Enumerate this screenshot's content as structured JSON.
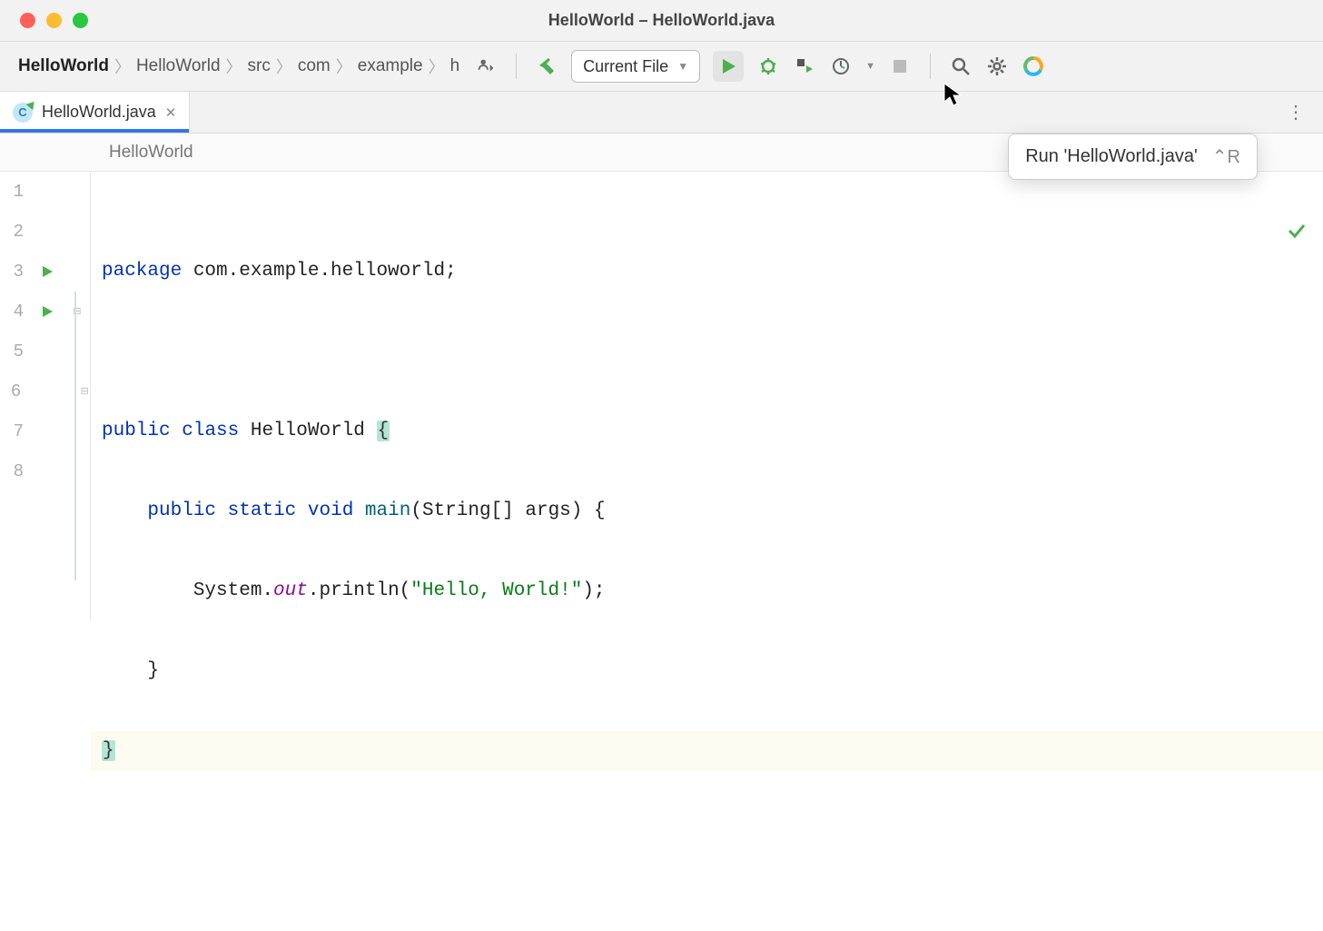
{
  "window": {
    "title": "HelloWorld – HelloWorld.java"
  },
  "breadcrumbs": [
    "HelloWorld",
    "HelloWorld",
    "src",
    "com",
    "example",
    "h"
  ],
  "run_config": {
    "label": "Current File"
  },
  "tab": {
    "label": "HelloWorld.java"
  },
  "context": {
    "label": "HelloWorld"
  },
  "tooltip": {
    "text": "Run 'HelloWorld.java'",
    "shortcut": "⌃R"
  },
  "code": {
    "kw_package": "package",
    "pkg_name": " com.example.helloworld",
    "semi": ";",
    "kw_public": "public",
    "kw_class": "class",
    "class_name": "HelloWorld",
    "lbrace": "{",
    "kw_public2": "public",
    "kw_static": "static",
    "kw_void": "void",
    "main": "main",
    "main_sig": "(String[] args) {",
    "sys1": "System.",
    "out": "out",
    "sys2": ".println(",
    "str": "\"Hello, World!\"",
    "sys3": ");",
    "rbrace_inner": "}",
    "rbrace_outer": "}"
  },
  "line_numbers": [
    "1",
    "2",
    "3",
    "4",
    "5",
    "6",
    "7",
    "8"
  ]
}
